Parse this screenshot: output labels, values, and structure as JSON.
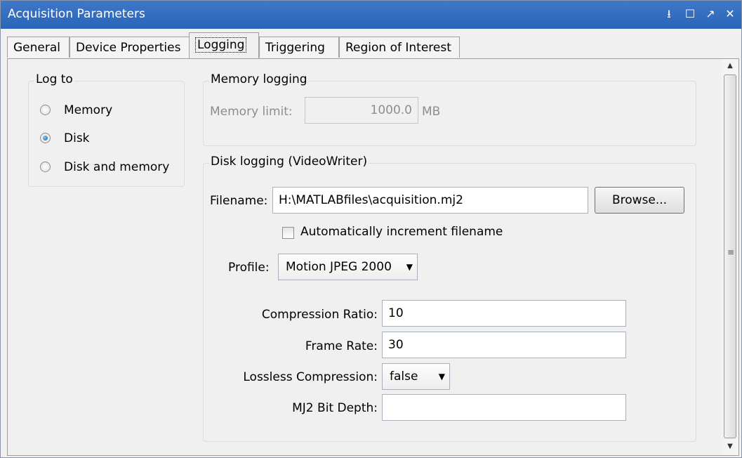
{
  "window": {
    "title": "Acquisition Parameters",
    "buttons": {
      "dock": "⭳",
      "maximize": "☐",
      "undock": "↗",
      "close": "✕"
    }
  },
  "tabs": [
    {
      "label": "General"
    },
    {
      "label": "Device Properties"
    },
    {
      "label": "Logging"
    },
    {
      "label": "Triggering"
    },
    {
      "label": "Region of Interest"
    }
  ],
  "log_to": {
    "legend": "Log to",
    "options": [
      {
        "label": "Memory",
        "selected": false
      },
      {
        "label": "Disk",
        "selected": true
      },
      {
        "label": "Disk and memory",
        "selected": false
      }
    ]
  },
  "memory_logging": {
    "legend": "Memory logging",
    "limit_label": "Memory limit:",
    "limit_value": "1000.0",
    "unit": "MB"
  },
  "disk_logging": {
    "legend": "Disk logging (VideoWriter)",
    "filename_label": "Filename:",
    "filename_value": "H:\\MATLABfiles\\acquisition.mj2",
    "browse_label": "Browse...",
    "auto_increment_label": "Automatically increment filename",
    "auto_increment_checked": false,
    "profile_label": "Profile:",
    "profile_value": "Motion JPEG 2000",
    "compression_ratio_label": "Compression Ratio:",
    "compression_ratio_value": "10",
    "frame_rate_label": "Frame Rate:",
    "frame_rate_value": "30",
    "lossless_label": "Lossless Compression:",
    "lossless_value": "false",
    "bit_depth_label": "MJ2 Bit Depth:",
    "bit_depth_value": ""
  },
  "scrollbar": {
    "up": "▲",
    "down": "▼",
    "grip": "≡"
  },
  "colors": {
    "titlebar": "#2f6cbf",
    "panel": "#f0f0f0",
    "radio_selected": "#1f5f9e"
  }
}
